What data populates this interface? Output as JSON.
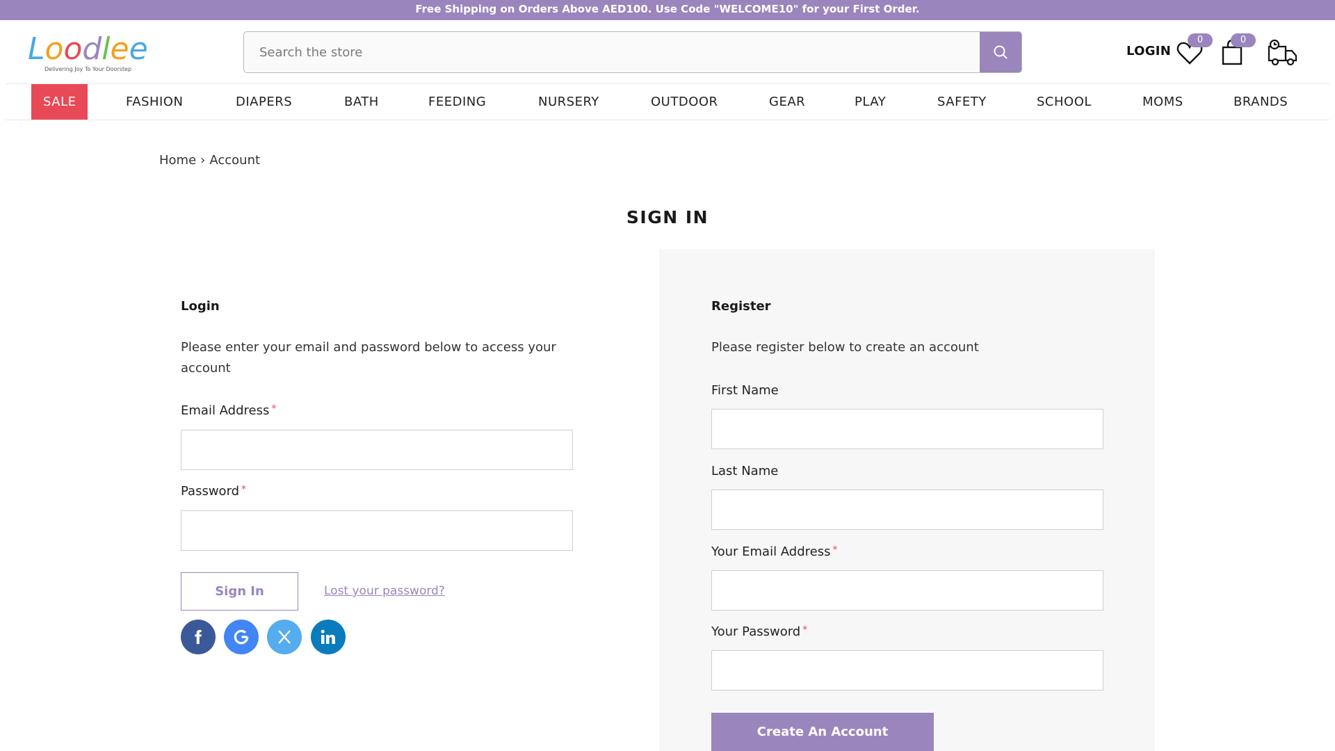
{
  "announcement": "Free Shipping on Orders Above AED100. Use Code \"WELCOME10\" for your First Order.",
  "logo": {
    "wordmark": "Loodlee",
    "tagline": "Delivering Joy To Your Doorstep"
  },
  "search": {
    "placeholder": "Search the store",
    "icon": "search-icon"
  },
  "header": {
    "login_label": "LOGIN",
    "wishlist_count": "0",
    "cart_count": "0",
    "icons": [
      "heart-icon",
      "shopping-bag-icon",
      "delivery-truck-icon"
    ]
  },
  "nav": {
    "items": [
      "SALE",
      "FASHION",
      "DIAPERS",
      "BATH",
      "FEEDING",
      "NURSERY",
      "OUTDOOR",
      "GEAR",
      "PLAY",
      "SAFETY",
      "SCHOOL",
      "MOMS",
      "BRANDS"
    ]
  },
  "breadcrumb": {
    "home": "Home",
    "current": "Account"
  },
  "page_title": "SIGN IN",
  "login": {
    "heading": "Login",
    "description": "Please enter your email and password below to access your account",
    "email_label": "Email Address",
    "password_label": "Password",
    "required_mark": "*",
    "email_value": "",
    "password_value": "",
    "submit_label": "Sign In",
    "lost_password": "Lost your password?",
    "social": [
      "facebook-icon",
      "google-icon",
      "x-icon",
      "linkedin-icon"
    ]
  },
  "register": {
    "heading": "Register",
    "description": "Please register below to create an account",
    "first_name_label": "First Name",
    "last_name_label": "Last Name",
    "email_label": "Your Email Address",
    "password_label": "Your Password",
    "required_mark": "*",
    "first_name_value": "",
    "last_name_value": "",
    "email_value": "",
    "password_value": "",
    "submit_label": "Create An Account"
  },
  "colors": {
    "brand": "#9a85bd",
    "sale": "#e94857",
    "facebook": "#3b5998",
    "google": "#4285f4",
    "x": "#55acee",
    "linkedin": "#0a7bbd"
  }
}
